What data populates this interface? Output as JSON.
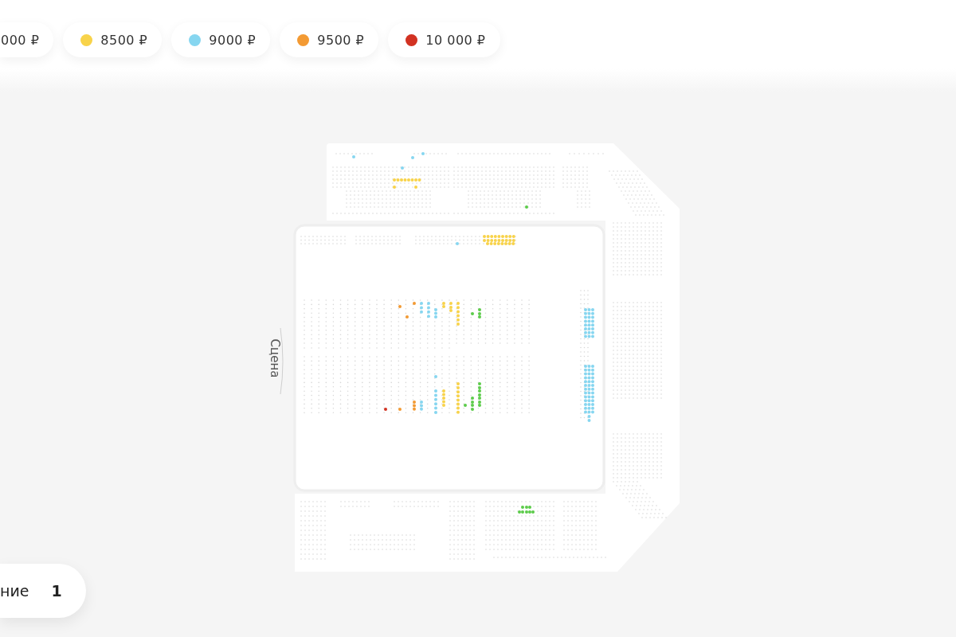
{
  "price_filters": [
    {
      "label": "000 ₽"
    },
    {
      "label": "8500 ₽",
      "color": "#f8d34a"
    },
    {
      "label": "9000 ₽",
      "color": "#86d6f0"
    },
    {
      "label": "9500 ₽",
      "color": "#f39a33"
    },
    {
      "label": "10 000 ₽",
      "color": "#d23222"
    }
  ],
  "seat_map": {
    "stage_label": "Сцена"
  },
  "cart": {
    "label": "ние",
    "count": "1"
  }
}
